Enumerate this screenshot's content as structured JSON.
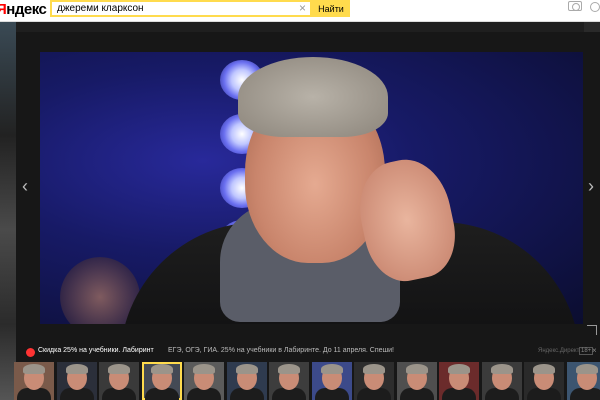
{
  "header": {
    "logo_prefix": "Я",
    "logo_rest": "ндекс",
    "search_value": "джереми кларксон",
    "clear_glyph": "×",
    "search_button": "Найти"
  },
  "viewer": {
    "nav_prev_glyph": "‹",
    "nav_next_glyph": "›"
  },
  "ad": {
    "badge": "Л",
    "title": "Скидка 25% на учебники. Лабиринт",
    "text": "ЕГЭ, ОГЭ, ГИА. 25% на учебники в Лабиринте. До 11 апреля. Спеши!",
    "source": "Яндекс.Директ",
    "tag": "18+",
    "close_glyph": "×"
  },
  "thumbnails": [
    {
      "bg": "#7a5a4a"
    },
    {
      "bg": "#2b2f3a"
    },
    {
      "bg": "#3a3a3a"
    },
    {
      "bg": "#444a55"
    },
    {
      "bg": "#5b5b5b"
    },
    {
      "bg": "#2f3b4f"
    },
    {
      "bg": "#3d3d3d"
    },
    {
      "bg": "#3c4a8a"
    },
    {
      "bg": "#2d2d2d"
    },
    {
      "bg": "#4f4f4f"
    },
    {
      "bg": "#6b2b2b"
    },
    {
      "bg": "#3b3b3b"
    },
    {
      "bg": "#2a2a2a"
    },
    {
      "bg": "#3c5570"
    },
    {
      "bg": "#3a3a3a"
    }
  ],
  "colors": {
    "accent": "#ffdb4d",
    "brand_red": "#ff0000",
    "viewer_bg": "#171717"
  }
}
